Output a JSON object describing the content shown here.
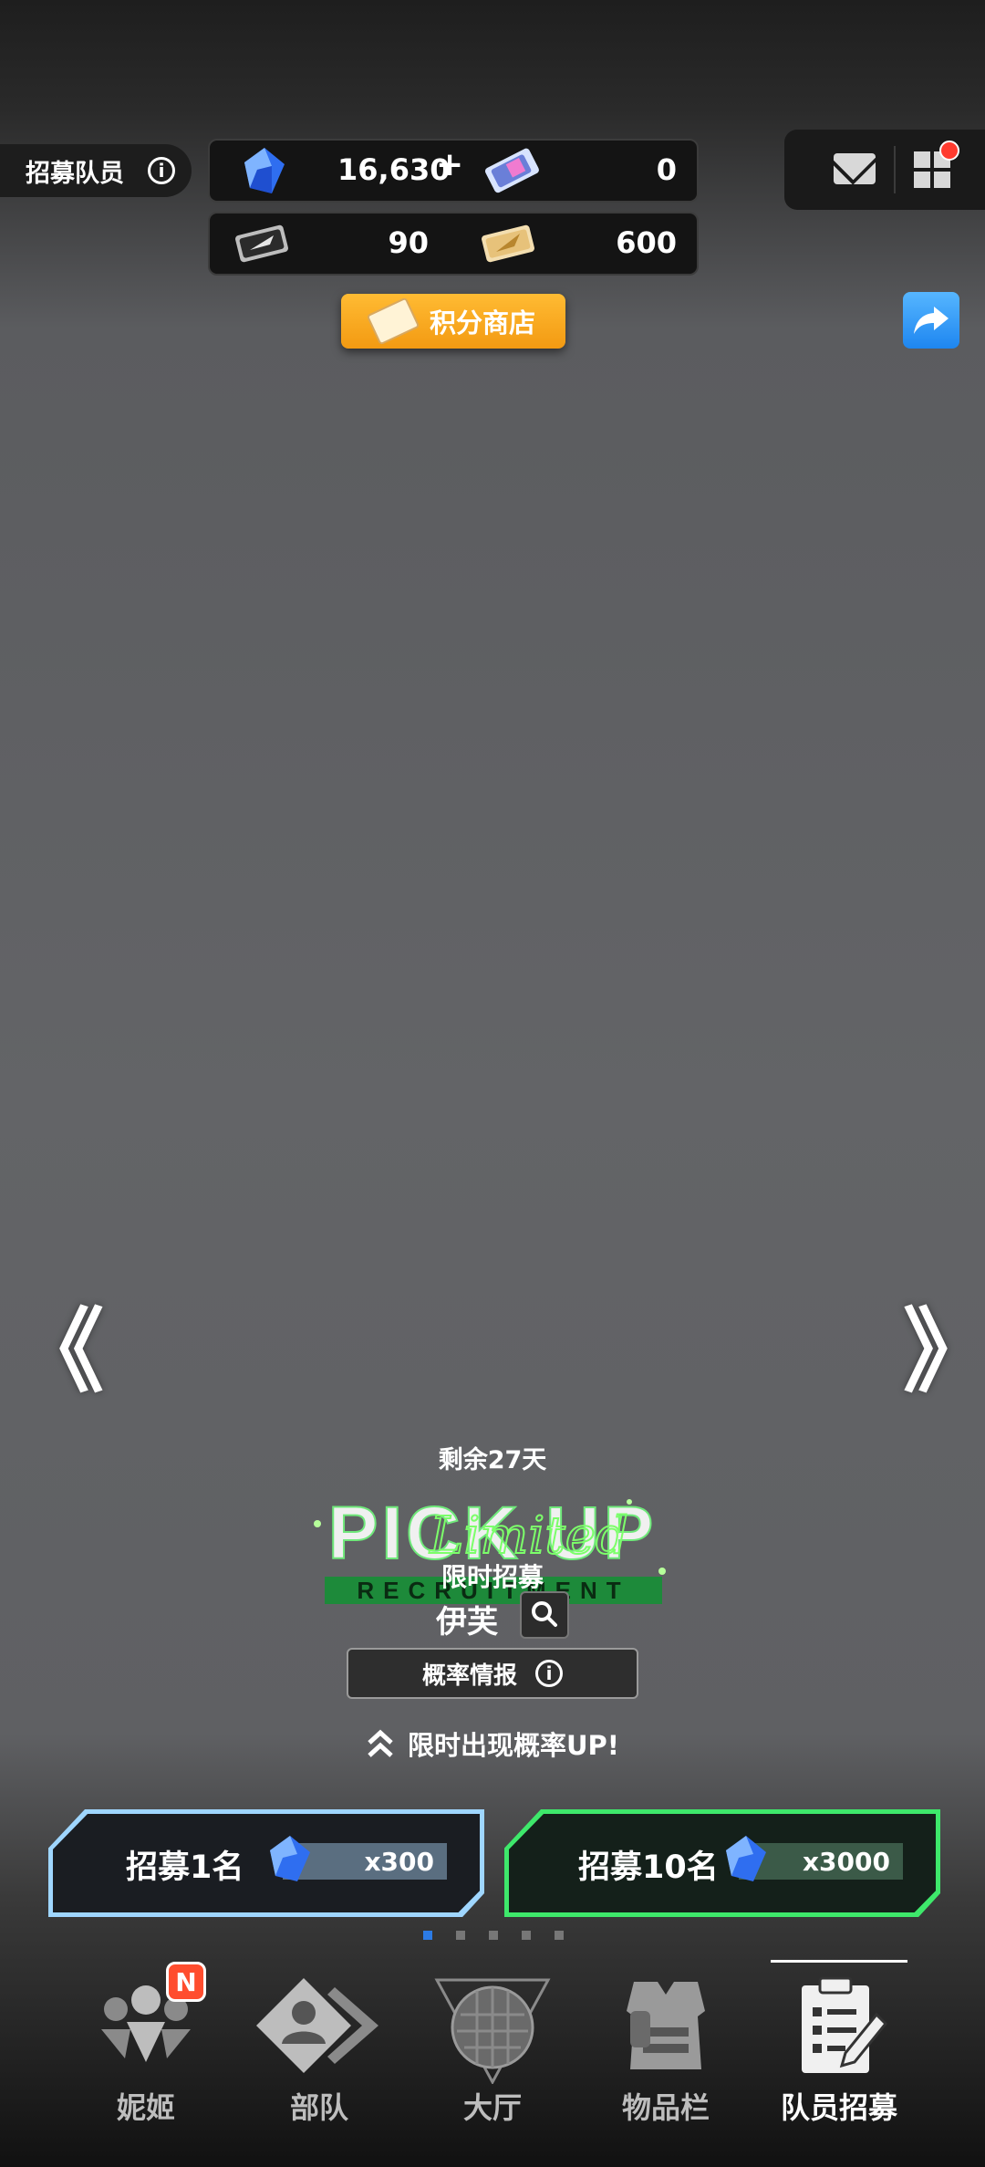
{
  "header": {
    "page_title": "招募队员",
    "currencies": {
      "gems": "16,630",
      "gem_plus": "+",
      "special_ticket": "0",
      "ticket_normal": "90",
      "ticket_gold": "600"
    },
    "shop_button": "积分商店",
    "has_notification": true
  },
  "banner": {
    "remaining": "剩余27天",
    "logo_text": "PICK UP",
    "logo_script": "Limited",
    "logo_sub": "RECRUITMENT",
    "type_label": "限时招募",
    "character_name": "伊芙",
    "rate_button": "概率情报",
    "up_note": "限时出现概率UP!"
  },
  "recruit": {
    "single": {
      "label": "招募1名",
      "cost": "x300"
    },
    "multi": {
      "label": "招募10名",
      "cost": "x3000"
    }
  },
  "pager": {
    "count": 5,
    "active": 0
  },
  "nav": {
    "items": [
      {
        "label": "妮姬",
        "badge": "N",
        "icon": "nikke-icon"
      },
      {
        "label": "部队",
        "icon": "squad-icon"
      },
      {
        "label": "大厅",
        "icon": "lobby-icon"
      },
      {
        "label": "物品栏",
        "icon": "inventory-icon"
      },
      {
        "label": "队员招募",
        "icon": "recruit-icon"
      }
    ],
    "active_index": 4
  },
  "colors": {
    "shop_orange": "#f5a623",
    "share_blue": "#2f8ff5",
    "recruit_single_border": "#9fd6ff",
    "recruit_multi_border": "#3ee86b",
    "badge_red": "#ff4d2e"
  }
}
